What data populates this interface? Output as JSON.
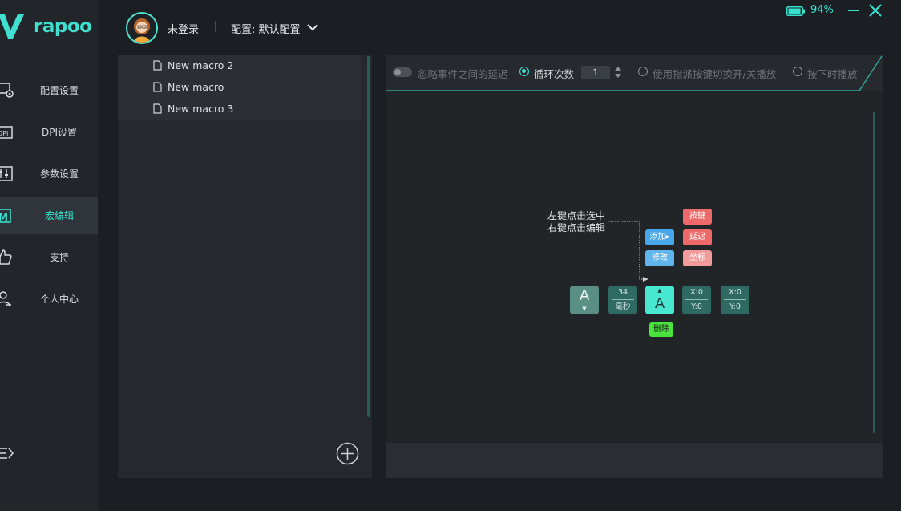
{
  "brand": {
    "name": "rapoo",
    "accent": "#35e2cf"
  },
  "header": {
    "login_status": "未登录",
    "separator": "|",
    "profile_label": "配置: 默认配置",
    "battery_pct": "94%",
    "battery_level": 0.94
  },
  "sidebar": {
    "items": [
      {
        "label": "配置设置",
        "icon": "config-icon"
      },
      {
        "label": "DPI设置",
        "icon": "dpi-icon"
      },
      {
        "label": "参数设置",
        "icon": "params-icon"
      },
      {
        "label": "宏编辑",
        "icon": "macro-icon",
        "active": true
      },
      {
        "label": "支持",
        "icon": "thumbs-up-icon"
      },
      {
        "label": "个人中心",
        "icon": "user-icon"
      }
    ]
  },
  "macros": {
    "items": [
      {
        "name": "New macro 2"
      },
      {
        "name": "New macro"
      },
      {
        "name": "New macro 3"
      }
    ]
  },
  "toolbar": {
    "ignore_delay": "忽略事件之间的延迟",
    "loop_count_label": "循环次数",
    "loop_count_value": "1",
    "toggle_label": "使用指派按键切换开/关播放",
    "hold_label": "按下时播放"
  },
  "help": {
    "line1": "左键点击选中",
    "line2": "右键点击编辑",
    "add": "添加",
    "modify": "修改",
    "key": "按键",
    "delay": "延迟",
    "coord": "坐标",
    "delete": "删除",
    "key_letter": "A",
    "delay_value": "34",
    "delay_unit": "毫秒",
    "x_label": "X:0",
    "y_label": "Y:0"
  }
}
